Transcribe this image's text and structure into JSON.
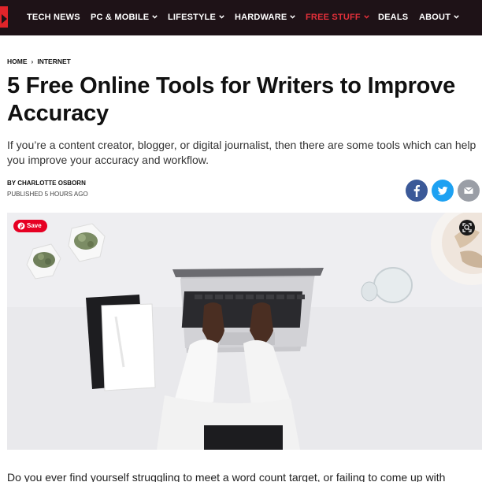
{
  "nav": {
    "items": [
      {
        "label": "TECH NEWS"
      },
      {
        "label": "PC & MOBILE"
      },
      {
        "label": "LIFESTYLE"
      },
      {
        "label": "HARDWARE"
      },
      {
        "label": "FREE STUFF"
      },
      {
        "label": "DEALS"
      },
      {
        "label": "ABOUT"
      }
    ],
    "accent_color": "#e3303a",
    "background_color": "#1e1217"
  },
  "breadcrumb": {
    "home": "HOME",
    "section": "INTERNET"
  },
  "article": {
    "title": "5 Free Online Tools for Writers to Improve Accuracy",
    "subtitle": "If you’re a content creator, blogger, or digital journalist, then there are some tools which can help you improve your accuracy and workflow.",
    "byline": "BY CHARLOTTE OSBORN",
    "published": "PUBLISHED 5 HOURS AGO",
    "body_first_line": "Do you ever find yourself struggling to meet a word count target, or failing to come up with"
  },
  "share": {
    "facebook_icon": "facebook-icon",
    "twitter_icon": "twitter-icon",
    "email_icon": "email-icon"
  },
  "hero": {
    "save_label": "Save"
  }
}
